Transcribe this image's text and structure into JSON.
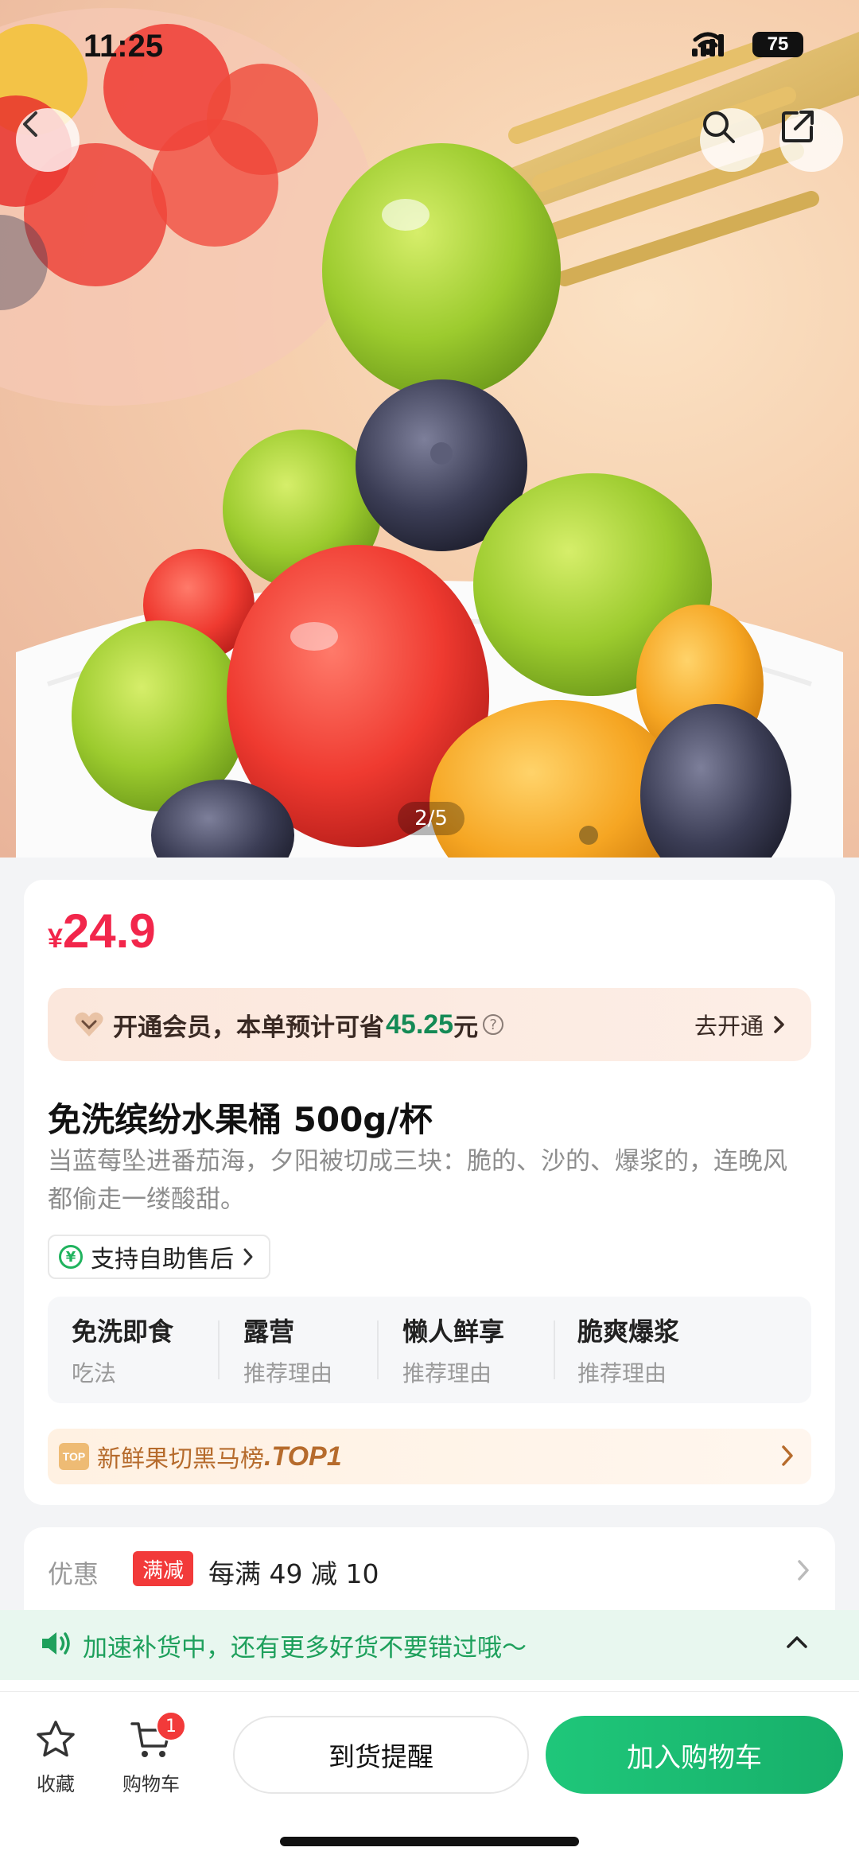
{
  "status_bar": {
    "time": "11:25",
    "battery": "75"
  },
  "hero": {
    "image_counter": "2/5"
  },
  "product": {
    "price_symbol": "¥",
    "price": "24.9",
    "member": {
      "text_prefix": "开通会员，本单预计可省",
      "amount": "45.25",
      "text_suffix": "元",
      "help": "?",
      "cta": "去开通"
    },
    "title": "免洗缤纷水果桶 500g/杯",
    "description": "当蓝莓坠进番茄海，夕阳被切成三块：脆的、沙的、爆浆的，连晚风都偷走一缕酸甜。",
    "after_sale": "支持自助售后",
    "after_sale_icon": "¥",
    "features": [
      {
        "main": "免洗即食",
        "sub": "吃法"
      },
      {
        "main": "露营",
        "sub": "推荐理由"
      },
      {
        "main": "懒人鲜享",
        "sub": "推荐理由"
      },
      {
        "main": "脆爽爆浆",
        "sub": "推荐理由"
      }
    ],
    "rank": {
      "badge": "TOP",
      "text": "新鲜果切黑马榜",
      "top": ".TOP1"
    }
  },
  "promo": {
    "label": "优惠",
    "tag": "满减",
    "text": "每满 49 减 10"
  },
  "restock": {
    "text": "加速补货中，还有更多好货不要错过哦～"
  },
  "bottom_bar": {
    "favorite_label": "收藏",
    "cart_label": "购物车",
    "cart_count": "1",
    "remind_label": "到货提醒",
    "add_cart_label": "加入购物车"
  },
  "colors": {
    "price": "#f2264b",
    "accent_green": "#1fc77a",
    "promo_red": "#f23a3a"
  }
}
